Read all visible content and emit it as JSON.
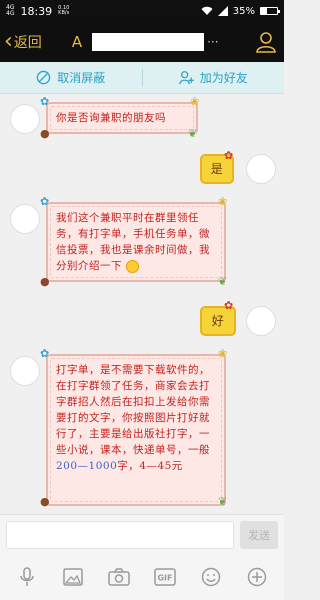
{
  "status": {
    "network": "4G",
    "network_sub": "4G",
    "time": "18:39",
    "speed_value": "0.10",
    "speed_unit": "KB/s",
    "battery": "35%",
    "battery_level": 0.35
  },
  "header": {
    "back_label": "返回",
    "title_initial": "A",
    "title_suffix": "···"
  },
  "actions": {
    "unblock_label": "取消屏蔽",
    "add_friend_label": "加为好友"
  },
  "messages": [
    {
      "side": "left",
      "text": "你是否询兼职的朋友吗"
    },
    {
      "side": "right",
      "text": "是"
    },
    {
      "side": "left",
      "text": "我们这个兼职平时在群里领任务，有打字单，手机任务单，微信投票，我也是课余时间做，我分别介绍一下"
    },
    {
      "side": "right",
      "text": "好"
    },
    {
      "side": "left",
      "text_before": "打字单，是不需要下载软件的，在打字群领了任务，商家会去打字群招人然后在扣扣上发给你需要打的文字，你按照图片打好就行了，主要是给出版社打字，一些小说，课本，快递单号，一般",
      "link": "200—1000",
      "text_after": "字，4—45元"
    }
  ],
  "composer": {
    "placeholder": "",
    "send_label": "发送"
  },
  "toolbar": {
    "gif_label": "GIF"
  },
  "colors": {
    "header_bg": "#0f0f0f",
    "header_accent": "#e5b94a",
    "action_bar_bg": "#dff0f3",
    "action_text": "#29a3c4",
    "bubble_pink": "#fde8e6",
    "bubble_text": "#c4231f",
    "bubble_yellow": "#f7d33a"
  }
}
